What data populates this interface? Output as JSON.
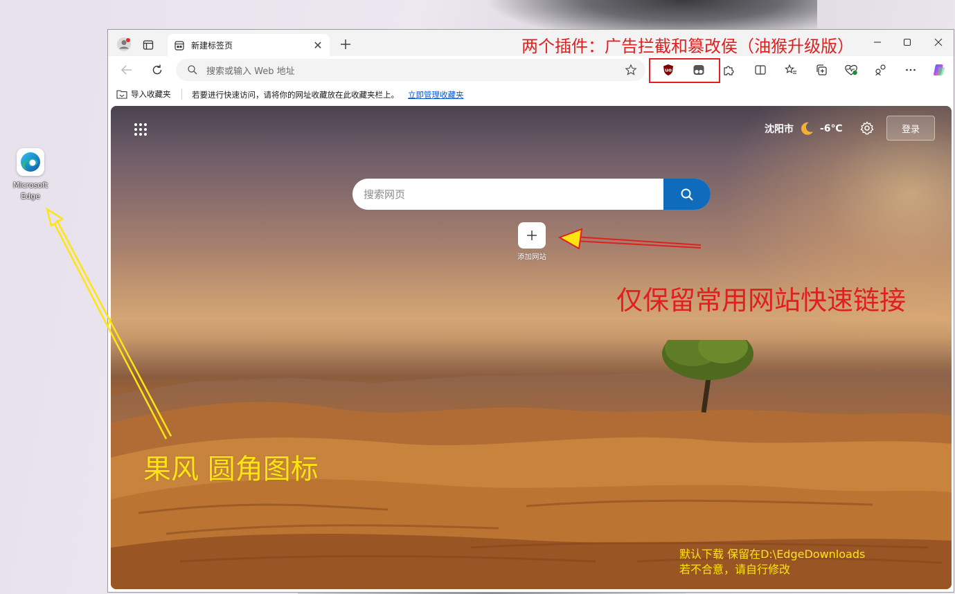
{
  "desktop": {
    "icon_label_line1": "Microsoft",
    "icon_label_line2": "Edge"
  },
  "browser": {
    "tab_title": "新建标签页",
    "address_placeholder": "搜索或输入 Web 地址",
    "favorites_import": "导入收藏夹",
    "favorites_hint": "若要进行快速访问，请将你的网址收藏放在此收藏夹栏上。",
    "favorites_manage_link": "立即管理收藏夹",
    "icons": {
      "profile": "profile-icon",
      "workspaces": "tab-actions-icon",
      "back": "back-arrow-icon",
      "refresh": "refresh-icon",
      "extensions": [
        "ublock-origin-icon",
        "tampermonkey-icon"
      ]
    }
  },
  "newtab": {
    "city": "沈阳市",
    "temperature": "-6℃",
    "login_label": "登录",
    "search_placeholder": "搜索网页",
    "add_site_label": "添加网站",
    "accent_color": "#0f6cbd"
  },
  "annotations": {
    "extensions_note": "两个插件：广告拦截和篡改侯（油猴升级版）",
    "quicklinks_note": "仅保留常用网站快速链接",
    "download_note_line1": "默认下载 保留在D:\\EdgeDownloads",
    "download_note_line2": "若不合意，请自行修改",
    "icon_note": "果风 圆角图标",
    "red": "#e01f1f",
    "yellow": "#ffe312"
  }
}
